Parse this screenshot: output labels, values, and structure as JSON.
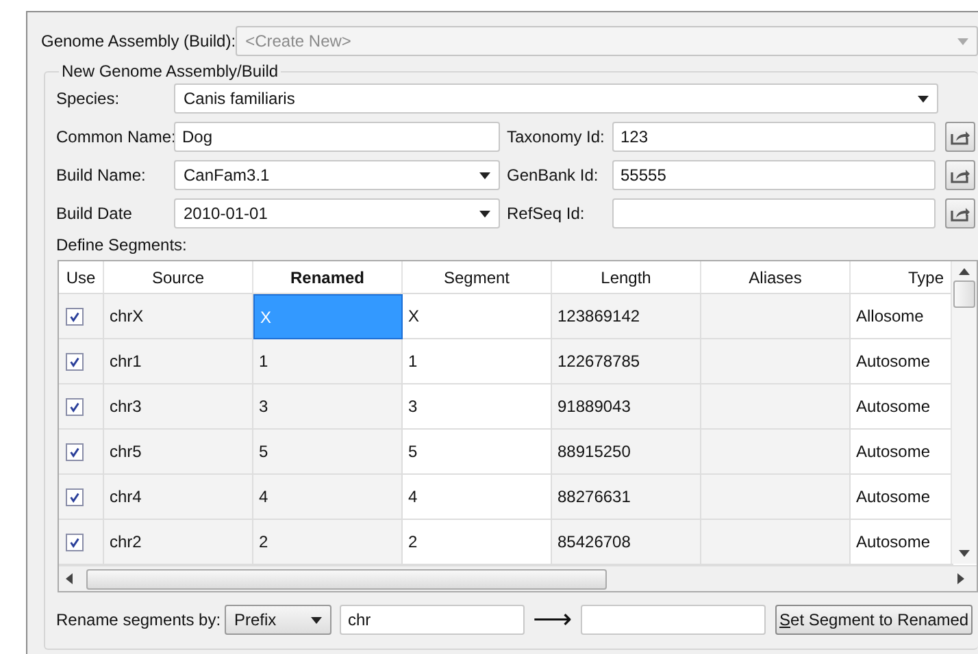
{
  "assembly": {
    "label": "Genome Assembly (Build):",
    "value": "<Create New>",
    "disabled": true
  },
  "group": {
    "title": "New Genome Assembly/Build",
    "species": {
      "label": "Species:",
      "value": "Canis familiaris"
    },
    "fields": [
      {
        "label": "Common Name:",
        "value": "Dog",
        "kind": "text",
        "side_label": "Taxonomy Id:",
        "side_value": "123"
      },
      {
        "label": "Build Name:",
        "value": "CanFam3.1",
        "kind": "combo",
        "side_label": "GenBank Id:",
        "side_value": "55555"
      },
      {
        "label": "Build Date",
        "value": "2010-01-01",
        "kind": "combo",
        "side_label": "RefSeq Id:"
      }
    ],
    "segments_label": "Define Segments:",
    "table": {
      "columns": [
        {
          "label": "Use",
          "emphasized": false
        },
        {
          "label": "Source",
          "emphasized": false
        },
        {
          "label": "Renamed",
          "emphasized": true
        },
        {
          "label": "Segment",
          "emphasized": false
        },
        {
          "label": "Length",
          "emphasized": false
        },
        {
          "label": "Aliases",
          "emphasized": false
        },
        {
          "label": "Type",
          "emphasized": false
        }
      ],
      "rows": [
        {
          "checked": true,
          "source": "chrX",
          "renamed": "X",
          "segment": "X",
          "length": "123869142",
          "type": "Allosome",
          "selected": true
        },
        {
          "checked": true,
          "source": "chr1",
          "renamed": "1",
          "segment": "1",
          "length": "122678785",
          "type": "Autosome",
          "selected": false
        },
        {
          "checked": true,
          "source": "chr3",
          "renamed": "3",
          "segment": "3",
          "length": "91889043",
          "type": "Autosome",
          "selected": false
        },
        {
          "checked": true,
          "source": "chr5",
          "renamed": "5",
          "segment": "5",
          "length": "88915250",
          "type": "Autosome",
          "selected": false
        },
        {
          "checked": true,
          "source": "chr4",
          "renamed": "4",
          "segment": "4",
          "length": "88276631",
          "type": "Autosome",
          "selected": false
        },
        {
          "checked": true,
          "source": "chr2",
          "renamed": "2",
          "segment": "2",
          "length": "85426708",
          "type": "Autosome",
          "selected": false
        }
      ]
    },
    "rename": {
      "label": "Rename segments by:",
      "mode": "Prefix",
      "from": "chr",
      "arrow": "⟶",
      "button": "Set Segment to Renamed"
    }
  }
}
